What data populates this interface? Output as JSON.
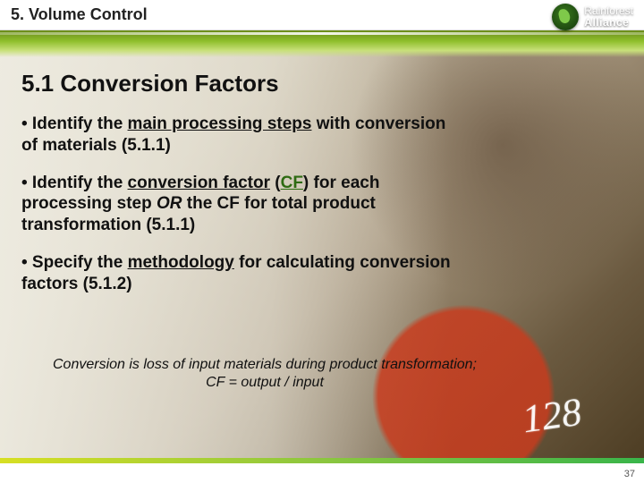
{
  "header": {
    "title": "5. Volume Control",
    "logo": {
      "line1": "Rainforest",
      "line2": "Alliance"
    }
  },
  "content": {
    "heading": "5.1 Conversion Factors",
    "bullets": [
      {
        "lead": "• Identify the ",
        "underlined": "main processing steps",
        "tail": " with conversion of materials (5.1.1)"
      },
      {
        "lead": "• Identify the ",
        "underlined": "conversion factor",
        "paren_open": " (",
        "cf": "CF",
        "paren_close": ") for each processing step ",
        "or": "OR",
        "tail": " the CF for total product transformation (5.1.1)"
      },
      {
        "lead": "• Specify the ",
        "underlined": "methodology",
        "tail": " for calculating conversion factors (5.1.2)"
      }
    ],
    "footnote_line1": "Conversion is loss of input materials during product transformation;",
    "footnote_line2": "CF = output / input"
  },
  "bg": {
    "chalk": "128"
  },
  "footer": {
    "page": "37"
  }
}
